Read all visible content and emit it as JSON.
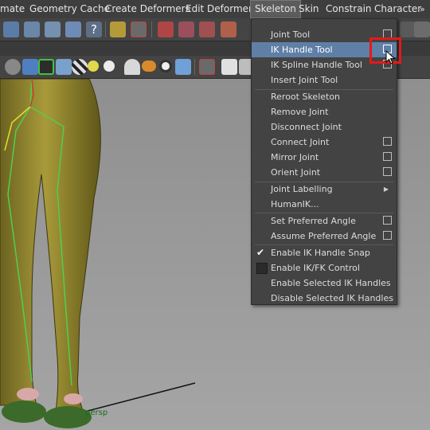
{
  "menubar": {
    "items": [
      "mate",
      "Geometry Cache",
      "Create Deformers",
      "Edit Deformers",
      "Skeleton",
      "Skin",
      "Constrain",
      "Character"
    ],
    "overflow": "»",
    "active": "Skeleton"
  },
  "skeleton_menu": {
    "items": [
      {
        "label": "Joint Tool",
        "option_box": true
      },
      {
        "label": "IK Handle Tool",
        "option_box": true,
        "highlighted": true
      },
      {
        "label": "IK Spline Handle Tool",
        "option_box": true
      },
      {
        "label": "Insert Joint Tool"
      },
      {
        "label": "Reroot Skeleton"
      },
      {
        "label": "Remove Joint"
      },
      {
        "label": "Disconnect Joint"
      },
      {
        "label": "Connect Joint",
        "option_box": true
      },
      {
        "label": "Mirror Joint",
        "option_box": true
      },
      {
        "label": "Orient Joint",
        "option_box": true
      },
      {
        "label": "Joint Labelling",
        "submenu": true
      },
      {
        "label": "HumanIK..."
      },
      {
        "label": "Set Preferred Angle",
        "option_box": true
      },
      {
        "label": "Assume Preferred Angle",
        "option_box": true
      },
      {
        "label": "Enable IK Handle Snap",
        "checked": true
      },
      {
        "label": "Enable IK/FK Control",
        "checked": false
      },
      {
        "label": "Enable Selected IK Handles"
      },
      {
        "label": "Disable Selected IK Handles"
      }
    ]
  },
  "viewport": {
    "camera_label": "persp"
  },
  "colors": {
    "highlight": "#5f7fa6",
    "callout": "#e21a1a",
    "menubar": "#3e3e3e",
    "menu_bg": "#434343"
  }
}
